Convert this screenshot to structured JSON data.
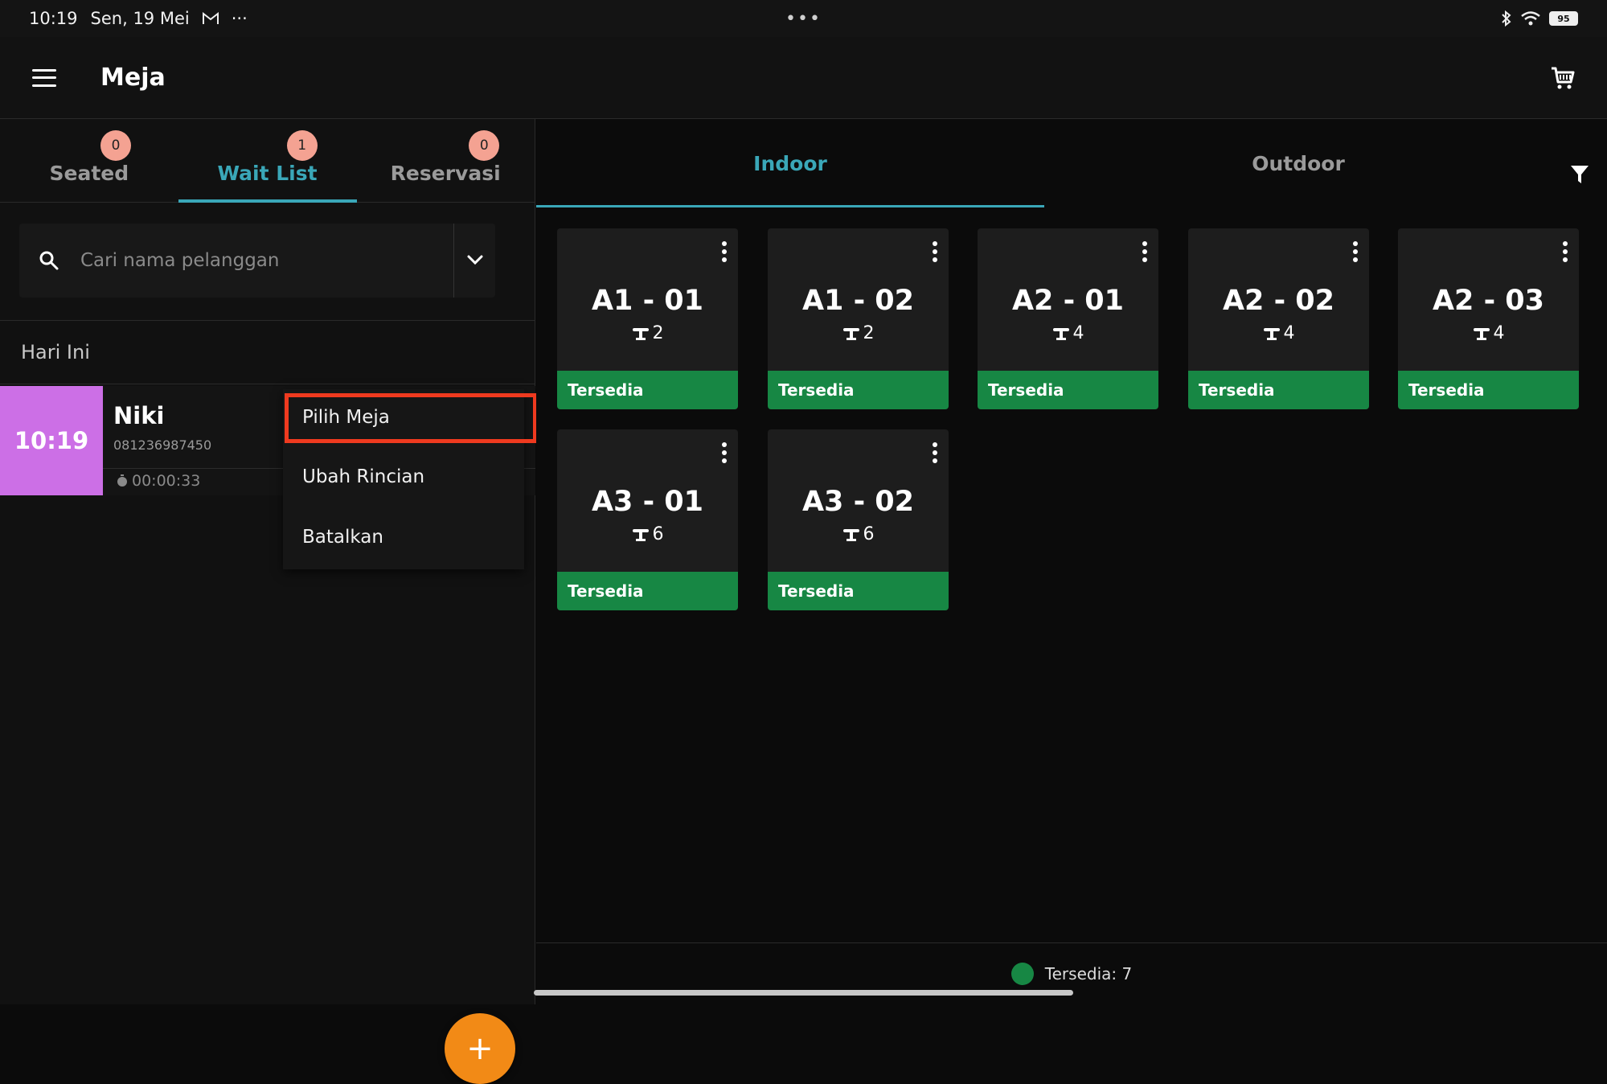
{
  "statusbar": {
    "time": "10:19",
    "date": "Sen, 19 Mei",
    "more": "···",
    "center_dots": "•••",
    "battery": "95"
  },
  "appbar": {
    "title": "Meja"
  },
  "left_tabs": [
    {
      "label": "Seated",
      "badge": "0"
    },
    {
      "label": "Wait List",
      "badge": "1"
    },
    {
      "label": "Reservasi",
      "badge": "0"
    }
  ],
  "search": {
    "placeholder": "Cari nama pelanggan"
  },
  "section_header": "Hari Ini",
  "wait_item": {
    "time": "10:19",
    "name": "Niki",
    "phone": "081236987450",
    "elapsed": "00:00:33"
  },
  "context_menu": {
    "items": [
      "Pilih Meja",
      "Ubah Rincian",
      "Batalkan"
    ]
  },
  "fab_label": "+",
  "right_tabs": [
    {
      "label": "Indoor"
    },
    {
      "label": "Outdoor"
    }
  ],
  "tables": [
    {
      "name": "A1 - 01",
      "seats": "2",
      "status": "Tersedia"
    },
    {
      "name": "A1 - 02",
      "seats": "2",
      "status": "Tersedia"
    },
    {
      "name": "A2 - 01",
      "seats": "4",
      "status": "Tersedia"
    },
    {
      "name": "A2 - 02",
      "seats": "4",
      "status": "Tersedia"
    },
    {
      "name": "A2 - 03",
      "seats": "4",
      "status": "Tersedia"
    },
    {
      "name": "A3 - 01",
      "seats": "6",
      "status": "Tersedia"
    },
    {
      "name": "A3 - 02",
      "seats": "6",
      "status": "Tersedia"
    }
  ],
  "footer": {
    "available": "Tersedia: 7"
  },
  "colors": {
    "accent": "#3aa7b8",
    "available": "#178744",
    "fab": "#f28a16",
    "badge": "#f4a292",
    "highlight": "#ef3a1f",
    "wait_time_bg": "#cc6fe6"
  },
  "icons": {
    "menu": "hamburger-icon",
    "cart": "cart-icon",
    "search": "search-icon",
    "dropdown": "chevron-down-icon",
    "filter": "filter-icon",
    "seat": "table-seat-icon",
    "more": "kebab-icon",
    "timer": "timer-icon"
  }
}
